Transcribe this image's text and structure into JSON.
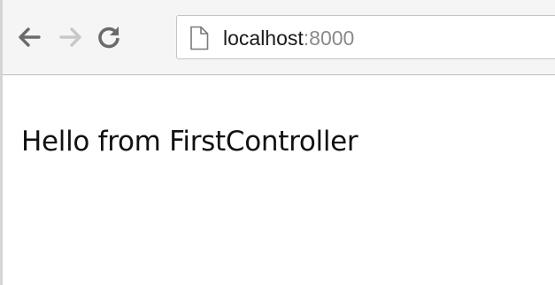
{
  "browser": {
    "nav": {
      "back_icon": "arrow-left-icon",
      "forward_icon": "arrow-right-icon",
      "reload_icon": "reload-icon"
    },
    "address_bar": {
      "page_icon": "document-icon",
      "host": "localhost",
      "port": ":8000"
    }
  },
  "page": {
    "message": "Hello from FirstController"
  },
  "colors": {
    "toolbar_bg": "#f5f5f5",
    "icon_active": "#6b6b6b",
    "icon_disabled": "#c8c8c8",
    "port_text": "#8a8a8a"
  }
}
